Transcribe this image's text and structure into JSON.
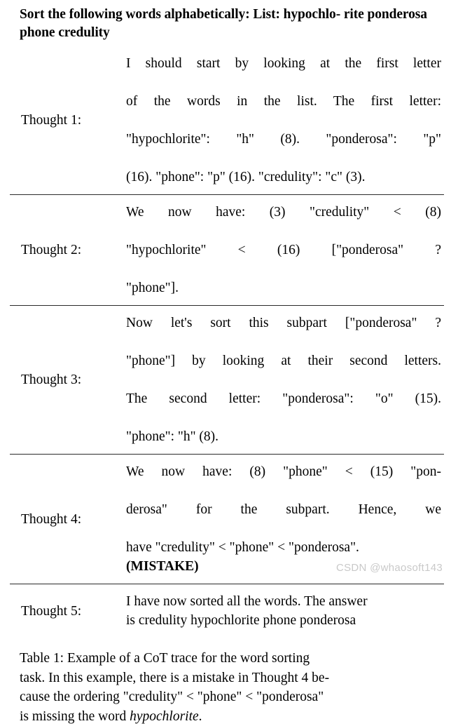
{
  "table": {
    "title": "Sort the following words alphabetically: List: hypochlo-rite ponderosa phone credulity",
    "title_lines": [
      "Sort the following words alphabetically: List: hypochlo-",
      "rite ponderosa phone credulity"
    ],
    "rows": [
      {
        "label": "Thought 1:",
        "lines": [
          "I should start by looking at the first letter",
          "of the words in the list.  The first letter:",
          "\"hypochlorite\": \"h\" (8). \"ponderosa\": \"p\"",
          "(16). \"phone\": \"p\" (16). \"credulity\": \"c\" (3)."
        ],
        "bold_suffix": ""
      },
      {
        "label": "Thought 2:",
        "lines": [
          "We now have:  (3) \"credulity\" < (8)",
          "\"hypochlorite\" < (16) [\"ponderosa\" ?",
          "\"phone\"]."
        ],
        "bold_suffix": ""
      },
      {
        "label": "Thought 3:",
        "lines": [
          "Now let's sort this subpart [\"ponderosa\" ?",
          "\"phone\"] by looking at their second letters.",
          "The second letter: \"ponderosa\": \"o\" (15).",
          "\"phone\": \"h\" (8)."
        ],
        "bold_suffix": ""
      },
      {
        "label": "Thought 4:",
        "lines": [
          "We now have: (8) \"phone\" < (15) \"pon-",
          "derosa\" for the subpart.  Hence, we",
          "have \"credulity\" < \"phone\" < \"ponderosa\"."
        ],
        "bold_suffix": "(MISTAKE)"
      },
      {
        "label": "Thought 5:",
        "lines": [
          "I have now sorted all the words. The answer",
          "is credulity hypochlorite phone ponderosa"
        ],
        "bold_suffix": ""
      }
    ]
  },
  "caption": {
    "lines": [
      "Table 1: Example of a CoT trace for the word sorting",
      "task. In this example, there is a mistake in Thought 4 be-",
      "cause the ordering \"credulity\" < \"phone\" < \"ponderosa\""
    ],
    "last_line_prefix": "is missing the word ",
    "last_line_italic": "hypochlorite",
    "last_line_suffix": "."
  },
  "watermark": {
    "text": "CSDN @whaosoft143"
  },
  "colors": {
    "text": "#000000",
    "rule": "#2b2b2b",
    "watermark": "#c9c9c9",
    "background": "#ffffff"
  }
}
